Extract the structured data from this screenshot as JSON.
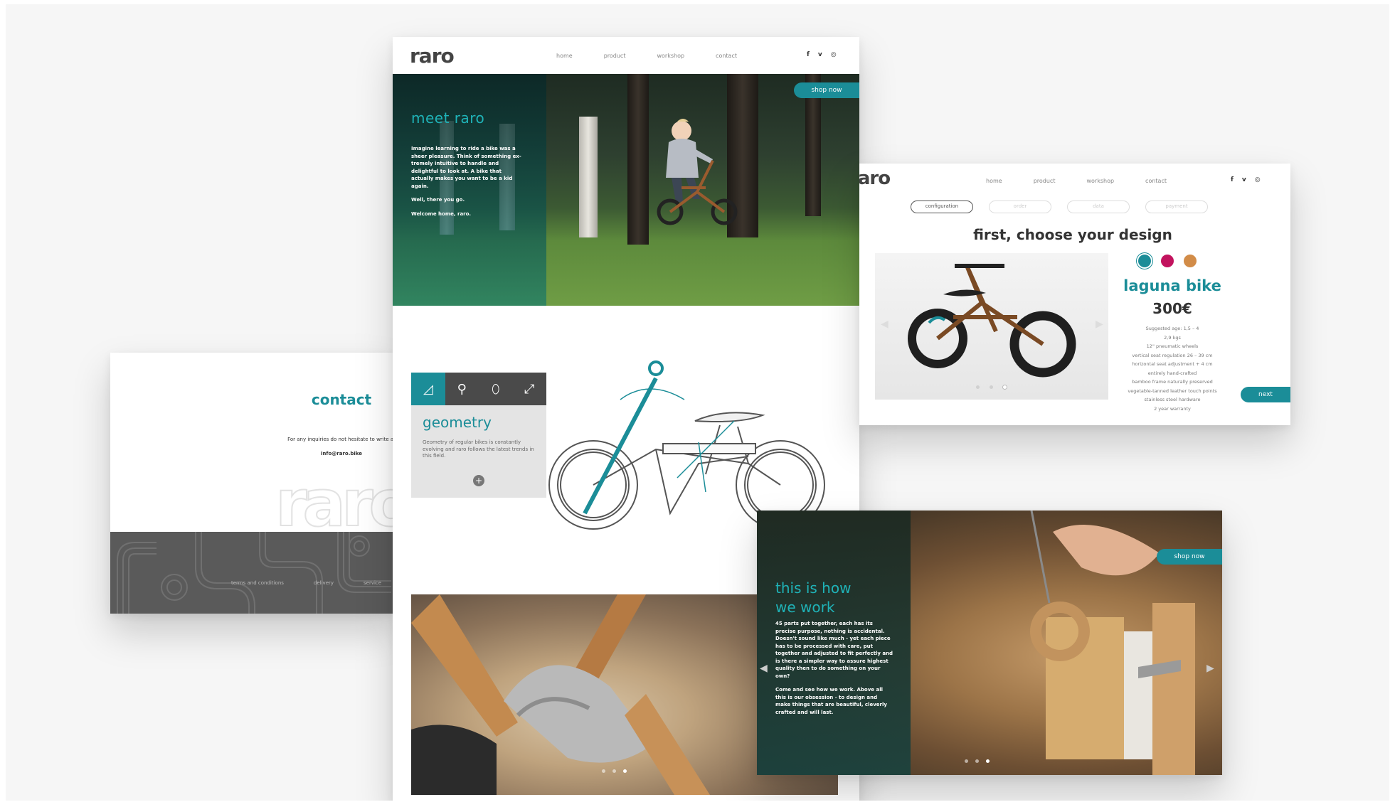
{
  "brand": {
    "logo": "raro",
    "accent": "#1b8d98"
  },
  "nav": {
    "home": "home",
    "product": "product",
    "workshop": "workshop",
    "contact": "contact"
  },
  "social": {
    "facebook": "f",
    "vimeo": "v",
    "instagram": "◎"
  },
  "hero": {
    "cta": "shop now",
    "title": "meet raro",
    "p1": "Imagine learning to ride a bike was a sheer pleasure. Think of something ex-tremely intuitive to handle and delightful to look at. A bike that actually makes you want to be a kid again.",
    "p2": "Well, there you go.",
    "p3": "Welcome home, raro."
  },
  "geometry": {
    "title": "geometry",
    "text": "Geometry of regular bikes is constantly evolving and raro follows the latest trends in this field.",
    "plus": "+",
    "icons": [
      "angle-icon",
      "magnifier-icon",
      "leaf-icon",
      "expand-icon"
    ]
  },
  "contact": {
    "title": "contact",
    "text": "For any inquiries do not hesitate to write at",
    "email": "info@raro.bike",
    "watermark": "raro",
    "footer": {
      "terms": "terms and conditions",
      "delivery": "delivery",
      "service": "service"
    }
  },
  "config": {
    "steps": [
      "configuration",
      "order",
      "data",
      "payment"
    ],
    "title": "first, choose your design",
    "colors": [
      "#1b8d98",
      "#c2135e",
      "#d28c48"
    ],
    "product": "laguna bike",
    "price": "300€",
    "specs": [
      "Suggested age: 1,5 – 4",
      "2,9 kgs",
      "12\" pneumatic wheels",
      "vertical seat regulation 26 – 39 cm",
      "horizontal seat adjustment + 4 cm",
      "entirely hand-crafted",
      "bamboo frame naturally preserved",
      "vegetable-tanned leather touch points",
      "stainless steel hardware",
      "2 year warranty"
    ],
    "next": "next"
  },
  "work": {
    "cta": "shop now",
    "title_line1": "this is how",
    "title_line2": "we work",
    "p1": "45 parts put together, each has its precise purpose, nothing is accidental. Doesn't sound like much - yet each piece has to be processed with care, put together and adjusted to fit perfectly and is there a simpler way to assure highest quality then to do something on your own?",
    "p2": "Come and see how we work. Above all this is our obsession - to design and make things that are beautiful, cleverly crafted and will last."
  }
}
